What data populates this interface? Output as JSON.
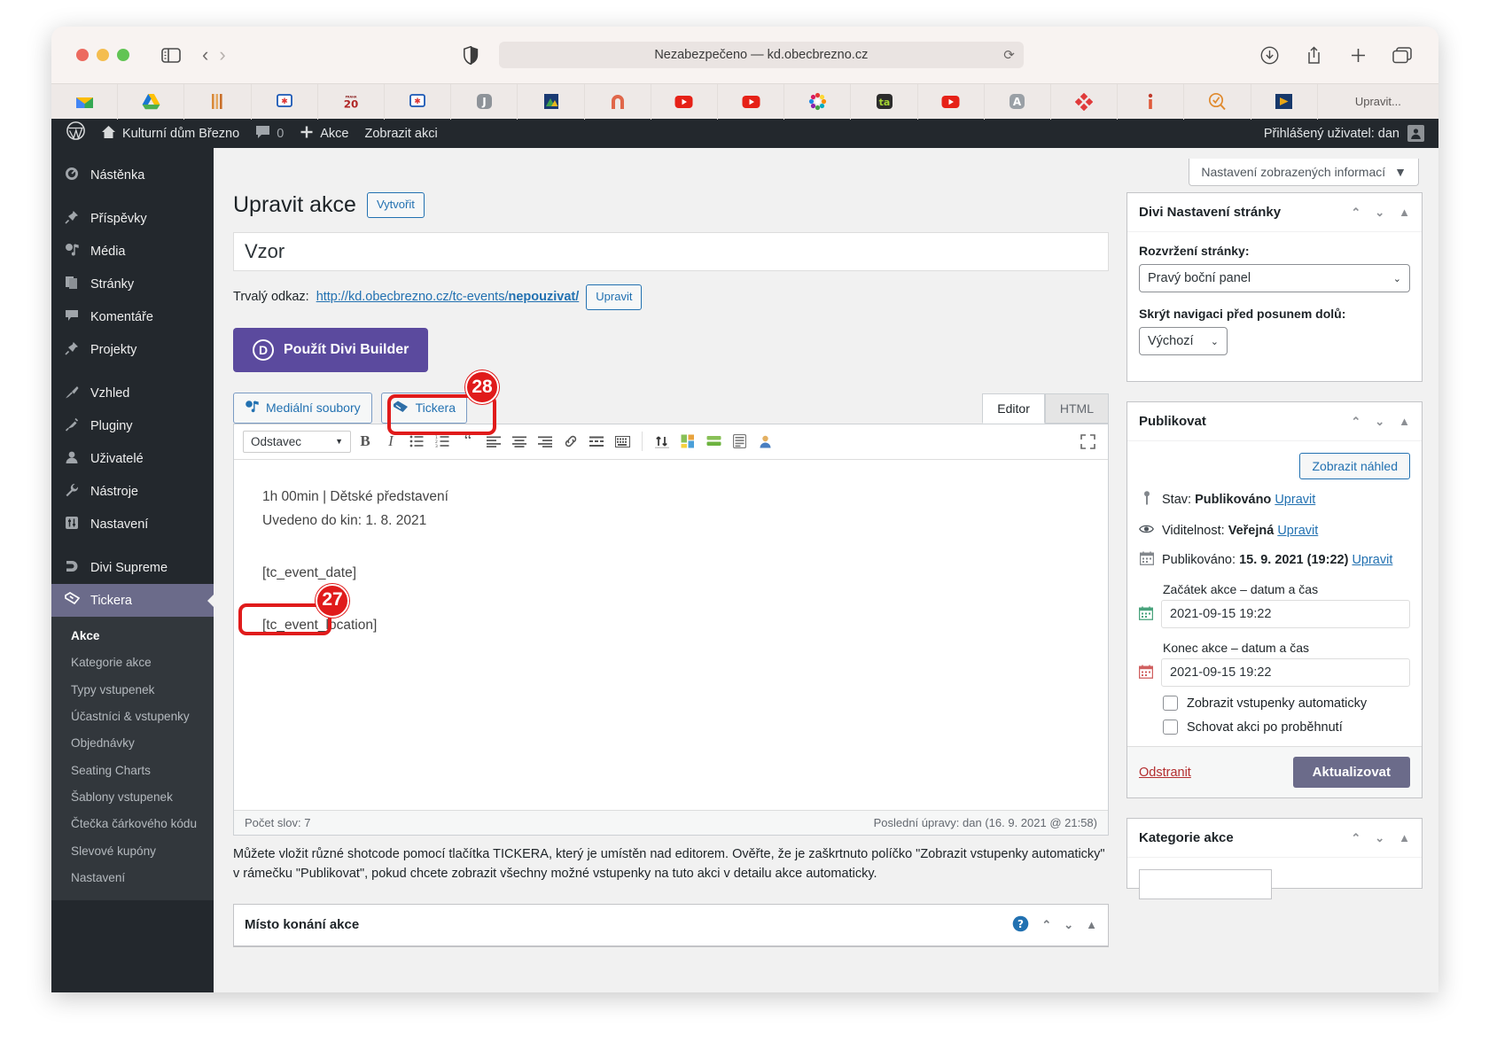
{
  "browser": {
    "url_text": "Nezabezpečeno — kd.obecbrezno.cz",
    "reload_icon": "reload-icon",
    "shield_icon": "shield-icon",
    "sidebar_icon": "sidebar-toggle-icon",
    "back_icon": "back-arrow-icon",
    "forward_icon": "forward-arrow-icon",
    "download_icon": "download-icon",
    "share_icon": "share-icon",
    "newtab_icon": "plus-icon",
    "tabs_icon": "tab-overview-icon",
    "bookmarks": [
      {
        "name": "gmail",
        "glyph": "M"
      },
      {
        "name": "google-drive",
        "glyph": "▲"
      },
      {
        "name": "bars",
        "glyph": "|||"
      },
      {
        "name": "ticket-blue",
        "glyph": "✦"
      },
      {
        "name": "praha-20",
        "glyph": "20"
      },
      {
        "name": "ticket-blue-2",
        "glyph": "✦"
      },
      {
        "name": "j-app",
        "glyph": "J"
      },
      {
        "name": "photos",
        "glyph": "▲"
      },
      {
        "name": "arch",
        "glyph": "∩"
      },
      {
        "name": "youtube",
        "glyph": "▶"
      },
      {
        "name": "youtube-2",
        "glyph": "▶"
      },
      {
        "name": "flower",
        "glyph": "✺"
      },
      {
        "name": "ta-app",
        "glyph": "ta"
      },
      {
        "name": "youtube-3",
        "glyph": "▶"
      },
      {
        "name": "a-app",
        "glyph": "A"
      },
      {
        "name": "red-diamond",
        "glyph": "❖"
      },
      {
        "name": "info-i",
        "glyph": "i"
      },
      {
        "name": "search-check",
        "glyph": "✓"
      },
      {
        "name": "play-flag",
        "glyph": "▶"
      }
    ],
    "bookmarks_overflow": "Upravit..."
  },
  "adminbar": {
    "wp_logo": "wordpress-logo",
    "site_name": "Kulturní dům Březno",
    "comments_count": "0",
    "new_label": "Akce",
    "view_label": "Zobrazit akci",
    "user_label": "Přihlášený uživatel: dan"
  },
  "sidebar": {
    "items": [
      {
        "label": "Nástěnka",
        "icon": "dashboard-icon"
      },
      {
        "label": "Příspěvky",
        "icon": "pin-icon"
      },
      {
        "label": "Média",
        "icon": "media-icon"
      },
      {
        "label": "Stránky",
        "icon": "pages-icon"
      },
      {
        "label": "Komentáře",
        "icon": "comment-icon"
      },
      {
        "label": "Projekty",
        "icon": "pin-icon"
      },
      {
        "label": "Vzhled",
        "icon": "brush-icon"
      },
      {
        "label": "Pluginy",
        "icon": "plug-icon"
      },
      {
        "label": "Uživatelé",
        "icon": "user-icon"
      },
      {
        "label": "Nástroje",
        "icon": "wrench-icon"
      },
      {
        "label": "Nastavení",
        "icon": "sliders-icon"
      },
      {
        "label": "Divi Supreme",
        "icon": "divi-icon"
      },
      {
        "label": "Tickera",
        "icon": "ticket-icon"
      }
    ],
    "submenu": [
      "Akce",
      "Kategorie akce",
      "Typy vstupenek",
      "Účastníci & vstupenky",
      "Objednávky",
      "Seating Charts",
      "Šablony vstupenek",
      "Čtečka čárkového kódu",
      "Slevové kupóny",
      "Nastavení"
    ]
  },
  "screen_options": {
    "label": "Nastavení zobrazených informací",
    "caret": "▼"
  },
  "main": {
    "page_title": "Upravit akce",
    "add_new_label": "Vytvořit",
    "title_value": "Vzor",
    "permalink_label": "Trvalý odkaz:",
    "permalink_prefix": "http://kd.obecbrezno.cz/tc-events/",
    "permalink_slug": "nepouzivat/",
    "permalink_edit": "Upravit",
    "divi_builder_label": "Použít Divi Builder",
    "media_button": "Mediální soubory",
    "tickera_button": "Tickera",
    "tab_editor": "Editor",
    "tab_html": "HTML",
    "format_select": "Odstavec",
    "toolbar_icons": [
      "bold-icon",
      "italic-icon",
      "bullet-list-icon",
      "numbered-list-icon",
      "blockquote-icon",
      "align-left-icon",
      "align-center-icon",
      "align-right-icon",
      "link-icon",
      "read-more-icon",
      "keyboard-icon",
      "toolbar-toggle-icon",
      "divi-modules-icon",
      "divi-row-icon",
      "divi-layout-icon",
      "divi-person-icon"
    ],
    "fullscreen_icon": "fullscreen-icon",
    "editor_lines": [
      "1h 00min | Dětské představení",
      "Uvedeno do kin: 1. 8. 2021",
      "[tc_event_date]",
      "[tc_event_location]"
    ],
    "word_count": "Počet slov: 7",
    "last_edit": "Poslední úpravy: dan (16. 9. 2021 @ 21:58)",
    "help_text": "Můžete vložit různé shotcode pomocí tlačítka TICKERA, který je umístěn nad editorem. Ověřte, že je zaškrtnuto políčko \"Zobrazit vstupenky automaticky\" v rámečku \"Publikovat\", pokud chcete zobrazit všechny možné vstupenky na tuto akci v detailu akce automaticky.",
    "venue_box_title": "Místo konání akce",
    "venue_help_icon": "help-icon"
  },
  "divi_panel": {
    "title": "Divi Nastavení stránky",
    "layout_label": "Rozvržení stránky:",
    "layout_value": "Pravý boční panel",
    "nav_label": "Skrýt navigaci před posunem dolů:",
    "nav_value": "Výchozí"
  },
  "publish_panel": {
    "title": "Publikovat",
    "preview_button": "Zobrazit náhled",
    "status_label": "Stav:",
    "status_value": "Publikováno",
    "status_edit": "Upravit",
    "visibility_label": "Viditelnost:",
    "visibility_value": "Veřejná",
    "visibility_edit": "Upravit",
    "published_label": "Publikováno:",
    "published_value": "15. 9. 2021 (19:22)",
    "published_edit": "Upravit",
    "start_label": "Začátek akce – datum a čas",
    "start_value": "2021-09-15 19:22",
    "end_label": "Konec akce – datum a čas",
    "end_value": "2021-09-15 19:22",
    "checkbox_auto": "Zobrazit vstupenky automaticky",
    "checkbox_hide": "Schovat akci po proběhnutí",
    "trash_label": "Odstranit",
    "update_label": "Aktualizovat"
  },
  "categories_panel": {
    "title": "Kategorie akce"
  },
  "annotations": [
    {
      "number": "27"
    },
    {
      "number": "28"
    }
  ],
  "colors": {
    "accent_purple": "#5b4a9e",
    "wp_dark": "#23282d",
    "link_blue": "#2271b1",
    "annotation_red": "#e01b1b"
  }
}
